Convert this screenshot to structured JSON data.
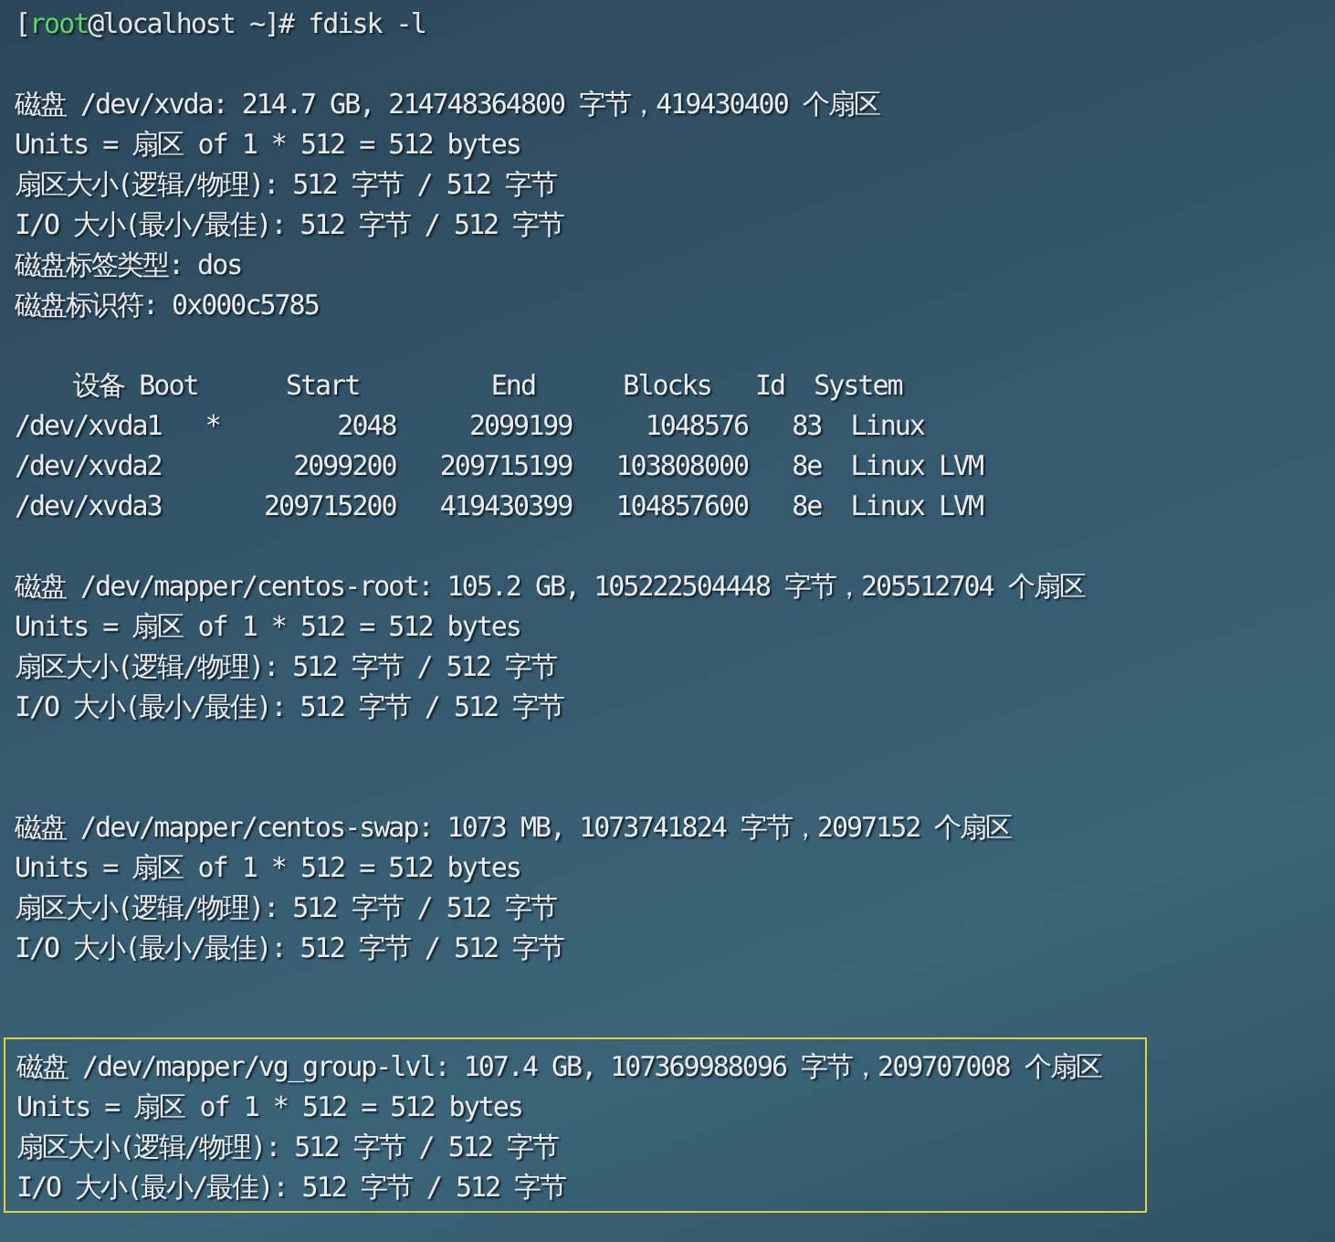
{
  "terminal": {
    "prompt": {
      "open": "[",
      "user": "root",
      "rest": "@localhost ~]# fdisk -l"
    },
    "sections": [
      {
        "highlighted": false,
        "lines": [
          "磁盘 /dev/xvda: 214.7 GB, 214748364800 字节，419430400 个扇区",
          "Units = 扇区 of 1 * 512 = 512 bytes",
          "扇区大小(逻辑/物理): 512 字节 / 512 字节",
          "I/O 大小(最小/最佳): 512 字节 / 512 字节",
          "磁盘标签类型: dos",
          "磁盘标识符: 0x000c5785"
        ]
      },
      {
        "highlighted": false,
        "lines": [
          "    设备 Boot      Start         End      Blocks   Id  System",
          "/dev/xvda1   *        2048     2099199     1048576   83  Linux",
          "/dev/xvda2         2099200   209715199   103808000   8e  Linux LVM",
          "/dev/xvda3       209715200   419430399   104857600   8e  Linux LVM"
        ]
      },
      {
        "highlighted": false,
        "lines": [
          "磁盘 /dev/mapper/centos-root: 105.2 GB, 105222504448 字节，205512704 个扇区",
          "Units = 扇区 of 1 * 512 = 512 bytes",
          "扇区大小(逻辑/物理): 512 字节 / 512 字节",
          "I/O 大小(最小/最佳): 512 字节 / 512 字节"
        ]
      },
      {
        "highlighted": false,
        "lines": [
          "磁盘 /dev/mapper/centos-swap: 1073 MB, 1073741824 字节，2097152 个扇区",
          "Units = 扇区 of 1 * 512 = 512 bytes",
          "扇区大小(逻辑/物理): 512 字节 / 512 字节",
          "I/O 大小(最小/最佳): 512 字节 / 512 字节"
        ]
      },
      {
        "highlighted": true,
        "lines": [
          "磁盘 /dev/mapper/vg_group-lvl: 107.4 GB, 107369988096 字节，209707008 个扇区",
          "Units = 扇区 of 1 * 512 = 512 bytes",
          "扇区大小(逻辑/物理): 512 字节 / 512 字节",
          "I/O 大小(最小/最佳): 512 字节 / 512 字节"
        ]
      }
    ]
  }
}
